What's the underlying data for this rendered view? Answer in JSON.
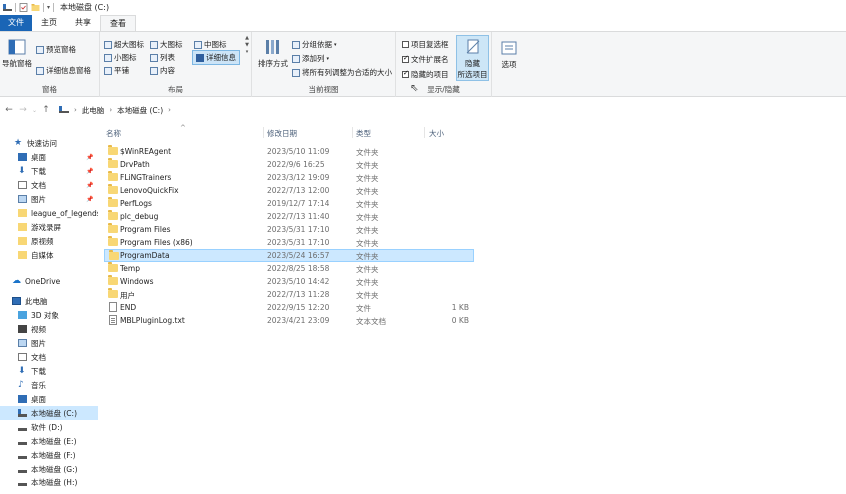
{
  "window": {
    "title": "本地磁盘 (C:)"
  },
  "tabs": [
    {
      "label": "文件"
    },
    {
      "label": "主页"
    },
    {
      "label": "共享"
    },
    {
      "label": "查看"
    }
  ],
  "ribbon": {
    "panes": {
      "label": "窗格",
      "nav_pane": "导航窗格",
      "preview_pane": "预览窗格",
      "details_pane": "详细信息窗格"
    },
    "layout": {
      "label": "布局",
      "items": [
        "超大图标",
        "大图标",
        "中图标",
        "小图标",
        "列表",
        "详细信息",
        "平铺",
        "内容"
      ],
      "selected": "详细信息"
    },
    "current_view": {
      "label": "当前视图",
      "sort_by": "排序方式",
      "group_by": "分组依据",
      "add_column": "添加列",
      "fit_columns": "将所有列调整为合适的大小"
    },
    "show_hide": {
      "label": "显示/隐藏",
      "item_checkboxes": "项目复选框",
      "file_extensions": "文件扩展名",
      "hidden_items": "隐藏的项目",
      "item_checkboxes_checked": false,
      "file_extensions_checked": true,
      "hidden_items_checked": true,
      "hide_selected_line1": "隐藏",
      "hide_selected_line2": "所选项目"
    },
    "options": "选项"
  },
  "address": {
    "crumbs": [
      "此电脑",
      "本地磁盘 (C:)"
    ]
  },
  "navpane": {
    "quick_access": "快速访问",
    "quick_items": [
      "桌面",
      "下载",
      "文档",
      "图片",
      "league_of_legends",
      "游戏录屏",
      "原视频",
      "自媒体"
    ],
    "onedrive": "OneDrive",
    "this_pc": "此电脑",
    "pc_items": [
      "3D 对象",
      "视频",
      "图片",
      "文档",
      "下载",
      "音乐",
      "桌面",
      "本地磁盘 (C:)",
      "软件 (D:)",
      "本地磁盘 (E:)",
      "本地磁盘 (F:)",
      "本地磁盘 (G:)",
      "本地磁盘 (H:)"
    ]
  },
  "columns": {
    "name": "名称",
    "date": "修改日期",
    "type": "类型",
    "size": "大小"
  },
  "files": [
    {
      "name": "$WinREAgent",
      "date": "2023/5/10 11:09",
      "type": "文件夹",
      "size": "",
      "kind": "folder"
    },
    {
      "name": "DrvPath",
      "date": "2022/9/6 16:25",
      "type": "文件夹",
      "size": "",
      "kind": "folder"
    },
    {
      "name": "FLiNGTrainers",
      "date": "2023/3/12 19:09",
      "type": "文件夹",
      "size": "",
      "kind": "folder"
    },
    {
      "name": "LenovoQuickFix",
      "date": "2022/7/13 12:00",
      "type": "文件夹",
      "size": "",
      "kind": "folder"
    },
    {
      "name": "PerfLogs",
      "date": "2019/12/7 17:14",
      "type": "文件夹",
      "size": "",
      "kind": "folder"
    },
    {
      "name": "plc_debug",
      "date": "2022/7/13 11:40",
      "type": "文件夹",
      "size": "",
      "kind": "folder"
    },
    {
      "name": "Program Files",
      "date": "2023/5/31 17:10",
      "type": "文件夹",
      "size": "",
      "kind": "folder"
    },
    {
      "name": "Program Files (x86)",
      "date": "2023/5/31 17:10",
      "type": "文件夹",
      "size": "",
      "kind": "folder"
    },
    {
      "name": "ProgramData",
      "date": "2023/5/24 16:57",
      "type": "文件夹",
      "size": "",
      "kind": "folder"
    },
    {
      "name": "Temp",
      "date": "2022/8/25 18:58",
      "type": "文件夹",
      "size": "",
      "kind": "folder"
    },
    {
      "name": "Windows",
      "date": "2023/5/10 14:42",
      "type": "文件夹",
      "size": "",
      "kind": "folder"
    },
    {
      "name": "用户",
      "date": "2022/7/13 11:28",
      "type": "文件夹",
      "size": "",
      "kind": "folder"
    },
    {
      "name": "END",
      "date": "2022/9/15 12:20",
      "type": "文件",
      "size": "1 KB",
      "kind": "file"
    },
    {
      "name": "MBLPluginLog.txt",
      "date": "2023/4/21 23:09",
      "type": "文本文档",
      "size": "0 KB",
      "kind": "txt"
    }
  ],
  "selected_file": "ProgramData"
}
